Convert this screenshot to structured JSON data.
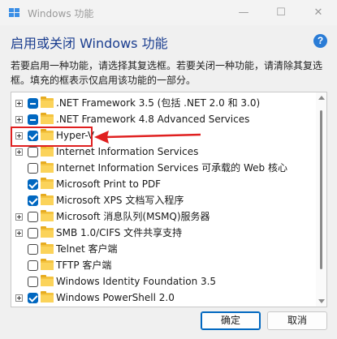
{
  "window": {
    "title": "Windows 功能",
    "controls": {
      "minimize": "—",
      "maximize": "☐",
      "close": "✕"
    }
  },
  "header": {
    "title": "启用或关闭 Windows 功能",
    "help": "?"
  },
  "description": "若要启用一种功能，请选择其复选框。若要关闭一种功能，请清除其复选框。填充的框表示仅启用该功能的一部分。",
  "features": [
    {
      "label": ".NET Framework 3.5 (包括 .NET 2.0 和 3.0)",
      "state": "partial",
      "expandable": true
    },
    {
      "label": ".NET Framework 4.8 Advanced Services",
      "state": "partial",
      "expandable": true
    },
    {
      "label": "Hyper-V",
      "state": "checked",
      "expandable": true
    },
    {
      "label": "Internet Information Services",
      "state": "unchecked",
      "expandable": true
    },
    {
      "label": "Internet Information Services 可承载的 Web 核心",
      "state": "unchecked",
      "expandable": false
    },
    {
      "label": "Microsoft Print to PDF",
      "state": "checked",
      "expandable": false
    },
    {
      "label": "Microsoft XPS 文档写入程序",
      "state": "checked",
      "expandable": false
    },
    {
      "label": "Microsoft 消息队列(MSMQ)服务器",
      "state": "unchecked",
      "expandable": true
    },
    {
      "label": "SMB 1.0/CIFS 文件共享支持",
      "state": "unchecked",
      "expandable": true
    },
    {
      "label": "Telnet 客户端",
      "state": "unchecked",
      "expandable": false
    },
    {
      "label": "TFTP 客户端",
      "state": "unchecked",
      "expandable": false
    },
    {
      "label": "Windows Identity Foundation 3.5",
      "state": "unchecked",
      "expandable": false
    },
    {
      "label": "Windows PowerShell 2.0",
      "state": "checked",
      "expandable": true
    }
  ],
  "buttons": {
    "ok": "确定",
    "cancel": "取消"
  },
  "colors": {
    "accent": "#0067c0",
    "annotation": "#e02020",
    "header": "#1a3d8f"
  }
}
